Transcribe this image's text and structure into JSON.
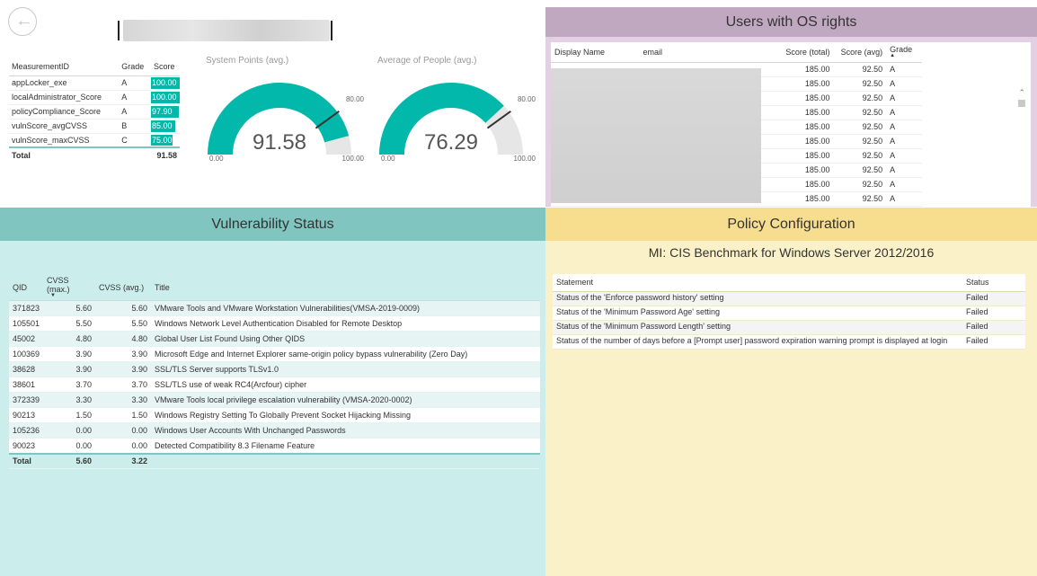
{
  "header": {
    "back_icon": "back-arrow-icon",
    "hostname_redacted": true
  },
  "measurement_table": {
    "columns": [
      "MeasurementID",
      "Grade",
      "Score"
    ],
    "rows": [
      {
        "id": "appLocker_exe",
        "grade": "A",
        "score": "100.00",
        "score_value": 100
      },
      {
        "id": "localAdministrator_Score",
        "grade": "A",
        "score": "100.00",
        "score_value": 100
      },
      {
        "id": "policyCompliance_Score",
        "grade": "A",
        "score": "97.90",
        "score_value": 97.9
      },
      {
        "id": "vulnScore_avgCVSS",
        "grade": "B",
        "score": "85.00",
        "score_value": 85
      },
      {
        "id": "vulnScore_maxCVSS",
        "grade": "C",
        "score": "75.00",
        "score_value": 75
      }
    ],
    "total_label": "Total",
    "total_score": "91.58"
  },
  "gauges": [
    {
      "title": "System Points (avg.)",
      "value": 91.58,
      "value_label": "91.58",
      "min_label": "0.00",
      "max_label": "100.00",
      "target": 80,
      "target_label": "80.00",
      "fill_color": "#01b8aa"
    },
    {
      "title": "Average of People (avg.)",
      "value": 76.29,
      "value_label": "76.29",
      "min_label": "0.00",
      "max_label": "100.00",
      "target": 80,
      "target_label": "80.00",
      "fill_color": "#01b8aa"
    }
  ],
  "users_panel": {
    "title": "Users with OS rights",
    "columns": [
      "Display Name",
      "email",
      "Score (total)",
      "Score (avg)",
      "Grade"
    ],
    "rows": [
      {
        "total": "185.00",
        "avg": "92.50",
        "grade": "A"
      },
      {
        "total": "185.00",
        "avg": "92.50",
        "grade": "A"
      },
      {
        "total": "185.00",
        "avg": "92.50",
        "grade": "A"
      },
      {
        "total": "185.00",
        "avg": "92.50",
        "grade": "A"
      },
      {
        "total": "185.00",
        "avg": "92.50",
        "grade": "A"
      },
      {
        "total": "185.00",
        "avg": "92.50",
        "grade": "A"
      },
      {
        "total": "185.00",
        "avg": "92.50",
        "grade": "A"
      },
      {
        "total": "185.00",
        "avg": "92.50",
        "grade": "A"
      },
      {
        "total": "185.00",
        "avg": "92.50",
        "grade": "A"
      },
      {
        "total": "185.00",
        "avg": "92.50",
        "grade": "A"
      }
    ]
  },
  "vuln_panel": {
    "title": "Vulnerability Status",
    "columns": [
      "QID",
      "CVSS (max.)",
      "CVSS (avg.)",
      "Title"
    ],
    "rows": [
      {
        "qid": "371823",
        "max": "5.60",
        "avg": "5.60",
        "title": "VMware Tools and VMware Workstation Vulnerabilities(VMSA-2019-0009)"
      },
      {
        "qid": "105501",
        "max": "5.50",
        "avg": "5.50",
        "title": "Windows Network Level Authentication Disabled for Remote Desktop"
      },
      {
        "qid": "45002",
        "max": "4.80",
        "avg": "4.80",
        "title": "Global User List Found Using Other QIDS"
      },
      {
        "qid": "100369",
        "max": "3.90",
        "avg": "3.90",
        "title": "Microsoft Edge and Internet Explorer same-origin policy bypass vulnerability (Zero Day)"
      },
      {
        "qid": "38628",
        "max": "3.90",
        "avg": "3.90",
        "title": "SSL/TLS Server supports TLSv1.0"
      },
      {
        "qid": "38601",
        "max": "3.70",
        "avg": "3.70",
        "title": "SSL/TLS use of weak RC4(Arcfour) cipher"
      },
      {
        "qid": "372339",
        "max": "3.30",
        "avg": "3.30",
        "title": "VMware Tools local privilege escalation vulnerability (VMSA-2020-0002)"
      },
      {
        "qid": "90213",
        "max": "1.50",
        "avg": "1.50",
        "title": "Windows Registry Setting To Globally Prevent Socket Hijacking Missing"
      },
      {
        "qid": "105236",
        "max": "0.00",
        "avg": "0.00",
        "title": "Windows User Accounts With Unchanged Passwords"
      },
      {
        "qid": "90023",
        "max": "0.00",
        "avg": "0.00",
        "title": "Detected Compatibility 8.3 Filename Feature"
      }
    ],
    "total_label": "Total",
    "total_max": "5.60",
    "total_avg": "3.22"
  },
  "policy_panel": {
    "title": "Policy Configuration",
    "subtitle": "MI: CIS Benchmark for Windows Server 2012/2016",
    "columns": [
      "Statement",
      "Status"
    ],
    "rows": [
      {
        "statement": "Status of the 'Enforce password history' setting",
        "status": "Failed"
      },
      {
        "statement": "Status of the 'Minimum Password Age' setting",
        "status": "Failed"
      },
      {
        "statement": "Status of the 'Minimum Password Length' setting",
        "status": "Failed"
      },
      {
        "statement": "Status of the number of days before a [Prompt user] password expiration warning prompt is displayed at login",
        "status": "Failed"
      }
    ]
  }
}
